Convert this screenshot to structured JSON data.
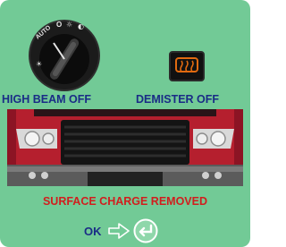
{
  "panel": {
    "high_beam_status": "HIGH BEAM OFF",
    "demister_status": "DEMISTER OFF",
    "surface_charge_status": "SURFACE CHARGE REMOVED",
    "ok_label": "OK"
  },
  "knob": {
    "positions": [
      "AUTO",
      "O",
      "☼"
    ]
  },
  "icons": {
    "headlight_switch": "headlight-switch-icon",
    "demister": "rear-window-demister-icon",
    "truck_front": "truck-front-image",
    "arrow": "right-arrow-icon",
    "enter": "enter-return-icon"
  },
  "colors": {
    "panel_bg": "#72ca96",
    "label_blue": "#1a2c86",
    "status_red": "#d11e1e",
    "demister_orange": "#e06a10",
    "truck_red": "#b51f2e"
  }
}
